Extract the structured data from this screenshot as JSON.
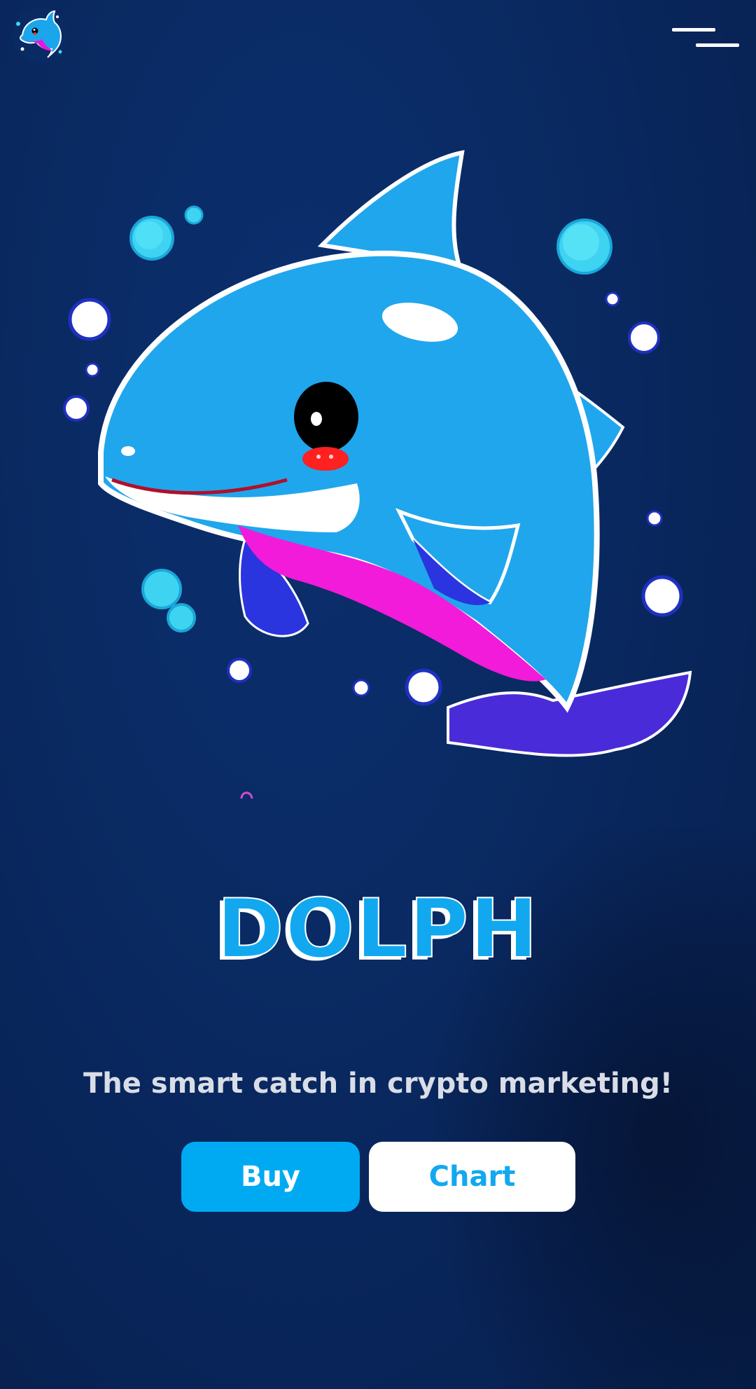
{
  "header": {
    "logo_icon": "dolphin-logo-icon",
    "menu_icon": "hamburger-menu-icon"
  },
  "hero": {
    "image_icon": "dolphin-mascot-illustration",
    "title": "DOLPH",
    "tagline": "The smart catch in crypto marketing!"
  },
  "actions": {
    "buy_label": "Buy",
    "chart_label": "Chart"
  },
  "colors": {
    "background": "#0a2a63",
    "accent": "#00aaf2",
    "tagline": "#d9dde6",
    "button_text_light": "#ffffff"
  }
}
